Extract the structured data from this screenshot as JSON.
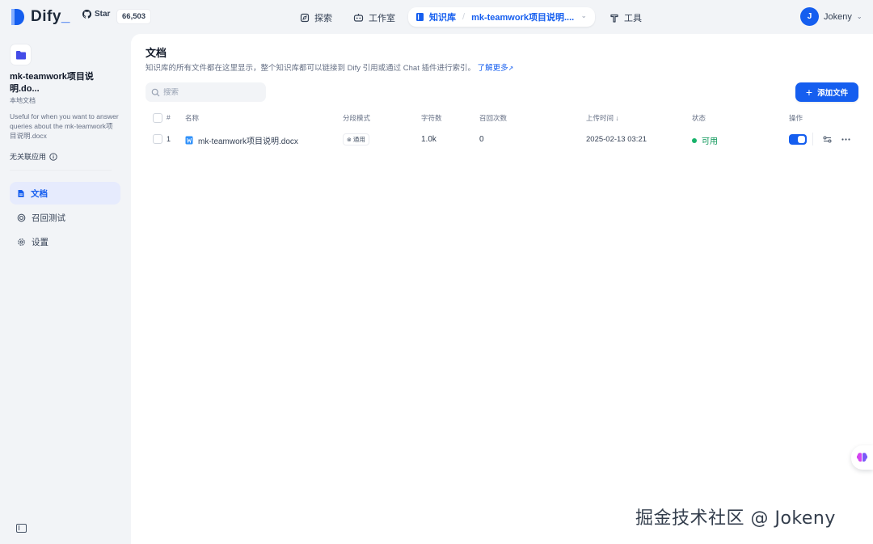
{
  "app": {
    "logo_text": "Dify",
    "github_label": "Star",
    "github_stars": "66,503"
  },
  "nav": {
    "explore": "探索",
    "studio": "工作室",
    "knowledge": "知识库",
    "dataset_name": "mk-teamwork项目说明....",
    "tools": "工具"
  },
  "user": {
    "initial": "J",
    "name": "Jokeny"
  },
  "sidebar": {
    "dataset_title": "mk-teamwork项目说明.do...",
    "dataset_type": "本地文档",
    "description": "Useful for when you want to answer queries about the mk-teamwork项目说明.docx",
    "related_apps": "无关联应用",
    "items": [
      {
        "label": "文档",
        "icon": "document-icon",
        "active": true
      },
      {
        "label": "召回测试",
        "icon": "target-icon",
        "active": false
      },
      {
        "label": "设置",
        "icon": "gear-icon",
        "active": false
      }
    ]
  },
  "main": {
    "title": "文档",
    "description": "知识库的所有文件都在这里显示，整个知识库都可以链接到 Dify 引用或通过 Chat 插件进行索引。",
    "learn_more": "了解更多",
    "search_placeholder": "搜索",
    "add_button": "添加文件",
    "columns": {
      "index": "#",
      "name": "名称",
      "chunk_mode": "分段模式",
      "chars": "字符数",
      "hits": "召回次数",
      "uploaded": "上传时间",
      "status": "状态",
      "actions": "操作"
    },
    "rows": [
      {
        "index": "1",
        "name": "mk-teamwork项目说明.docx",
        "chunk_mode": "通用",
        "chars": "1.0k",
        "hits": "0",
        "uploaded": "2025-02-13 03:21",
        "status": "可用",
        "enabled": true
      }
    ]
  },
  "watermark": "掘金技术社区 @ Jokeny",
  "colors": {
    "accent": "#155eef",
    "status_ok": "#17b26a",
    "background": "#f2f4f7"
  }
}
